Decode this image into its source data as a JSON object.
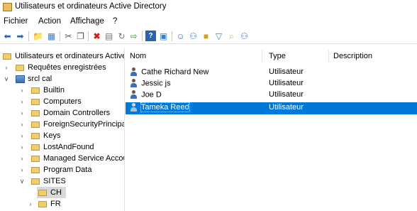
{
  "window": {
    "title": "Utilisateurs et ordinateurs Active Directory"
  },
  "menu": {
    "items": [
      "Fichier",
      "Action",
      "Affichage",
      "?"
    ]
  },
  "toolbar": {
    "buttons": [
      "back-arrow-icon",
      "forward-arrow-icon",
      "up-folder-icon",
      "show-hide-tree-icon",
      "cut-icon",
      "copy-icon",
      "delete-icon",
      "properties-icon",
      "refresh-icon",
      "export-icon",
      "help-icon",
      "view-icon",
      "new-user-icon",
      "new-group-icon",
      "new-ou-icon",
      "filter-icon",
      "find-icon",
      "add-to-group-icon"
    ]
  },
  "tree": {
    "root": "Utilisateurs et ordinateurs Active",
    "saved_queries": "Requêtes enregistrées",
    "domain": "srcl        cal",
    "items": [
      "Builtin",
      "Computers",
      "Domain Controllers",
      "ForeignSecurityPrincipals",
      "Keys",
      "LostAndFound",
      "Managed Service Accour",
      "Program Data",
      "SITES",
      "CH",
      "FR"
    ]
  },
  "list": {
    "headers": {
      "name": "Nom",
      "type": "Type",
      "description": "Description"
    },
    "rows": [
      {
        "name": "Cathe     Richard New",
        "type": "Utilisateur",
        "description": ""
      },
      {
        "name": "Jessic         js",
        "type": "Utilisateur",
        "description": ""
      },
      {
        "name": "Joe D",
        "type": "Utilisateur",
        "description": ""
      },
      {
        "name": "Tameka Reed",
        "type": "Utilisateur",
        "description": ""
      }
    ],
    "selected_index": 3
  },
  "colors": {
    "selection": "#0078d7",
    "folder": "#f2cd6b"
  }
}
